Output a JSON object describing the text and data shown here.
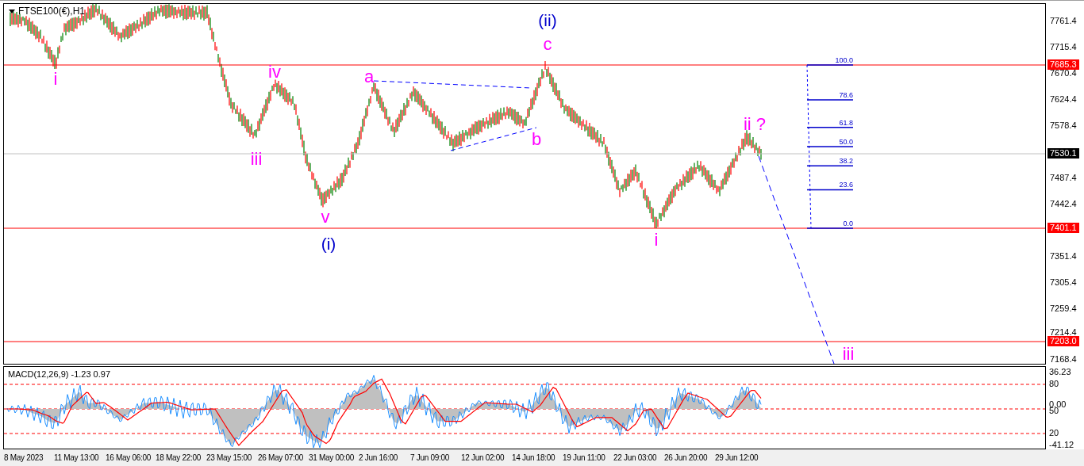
{
  "chart": {
    "title": "FTSE100(€),H1",
    "price_ticks": [
      "7761.4",
      "7715.4",
      "7670.4",
      "7624.4",
      "7578.4",
      "7487.4",
      "7442.4",
      "7351.4",
      "7305.4",
      "7259.4",
      "7214.4",
      "7168.4"
    ],
    "price_tags": [
      {
        "text": "7685.3",
        "color": "#ff0000"
      },
      {
        "text": "7530.1",
        "color": "#000000"
      },
      {
        "text": "7401.1",
        "color": "#ff0000"
      },
      {
        "text": "7203.0",
        "color": "#ff0000"
      }
    ],
    "wave_labels": [
      {
        "text": "i",
        "color": "#ff00ff"
      },
      {
        "text": "iv",
        "color": "#ff00ff"
      },
      {
        "text": "iii",
        "color": "#ff00ff"
      },
      {
        "text": "v",
        "color": "#ff00ff"
      },
      {
        "text": "(i)",
        "color": "#0000cc"
      },
      {
        "text": "a",
        "color": "#ff00ff"
      },
      {
        "text": "b",
        "color": "#ff00ff"
      },
      {
        "text": "c",
        "color": "#ff00ff"
      },
      {
        "text": "(ii)",
        "color": "#0000cc"
      },
      {
        "text": "ii ?",
        "color": "#ff00ff"
      },
      {
        "text": "i",
        "color": "#ff00ff"
      },
      {
        "text": "iii",
        "color": "#ff00ff"
      }
    ],
    "fib_levels": [
      "100.0",
      "78.6",
      "61.8",
      "50.0",
      "38.2",
      "23.6",
      "0.0"
    ]
  },
  "macd": {
    "title": "MACD(12,26,9) -1.23 0.97",
    "ticks": [
      "36.23",
      "80",
      "0.00",
      "50",
      "20",
      "-41.12"
    ]
  },
  "time_axis": [
    "8 May 2023",
    "11 May 13:00",
    "16 May 06:00",
    "18 May 22:00",
    "23 May 15:00",
    "26 May 07:00",
    "31 May 00:00",
    "2 Jun 16:00",
    "7 Jun 09:00",
    "12 Jun 02:00",
    "14 Jun 18:00",
    "19 Jun 11:00",
    "22 Jun 03:00",
    "26 Jun 20:00",
    "29 Jun 12:00"
  ]
}
